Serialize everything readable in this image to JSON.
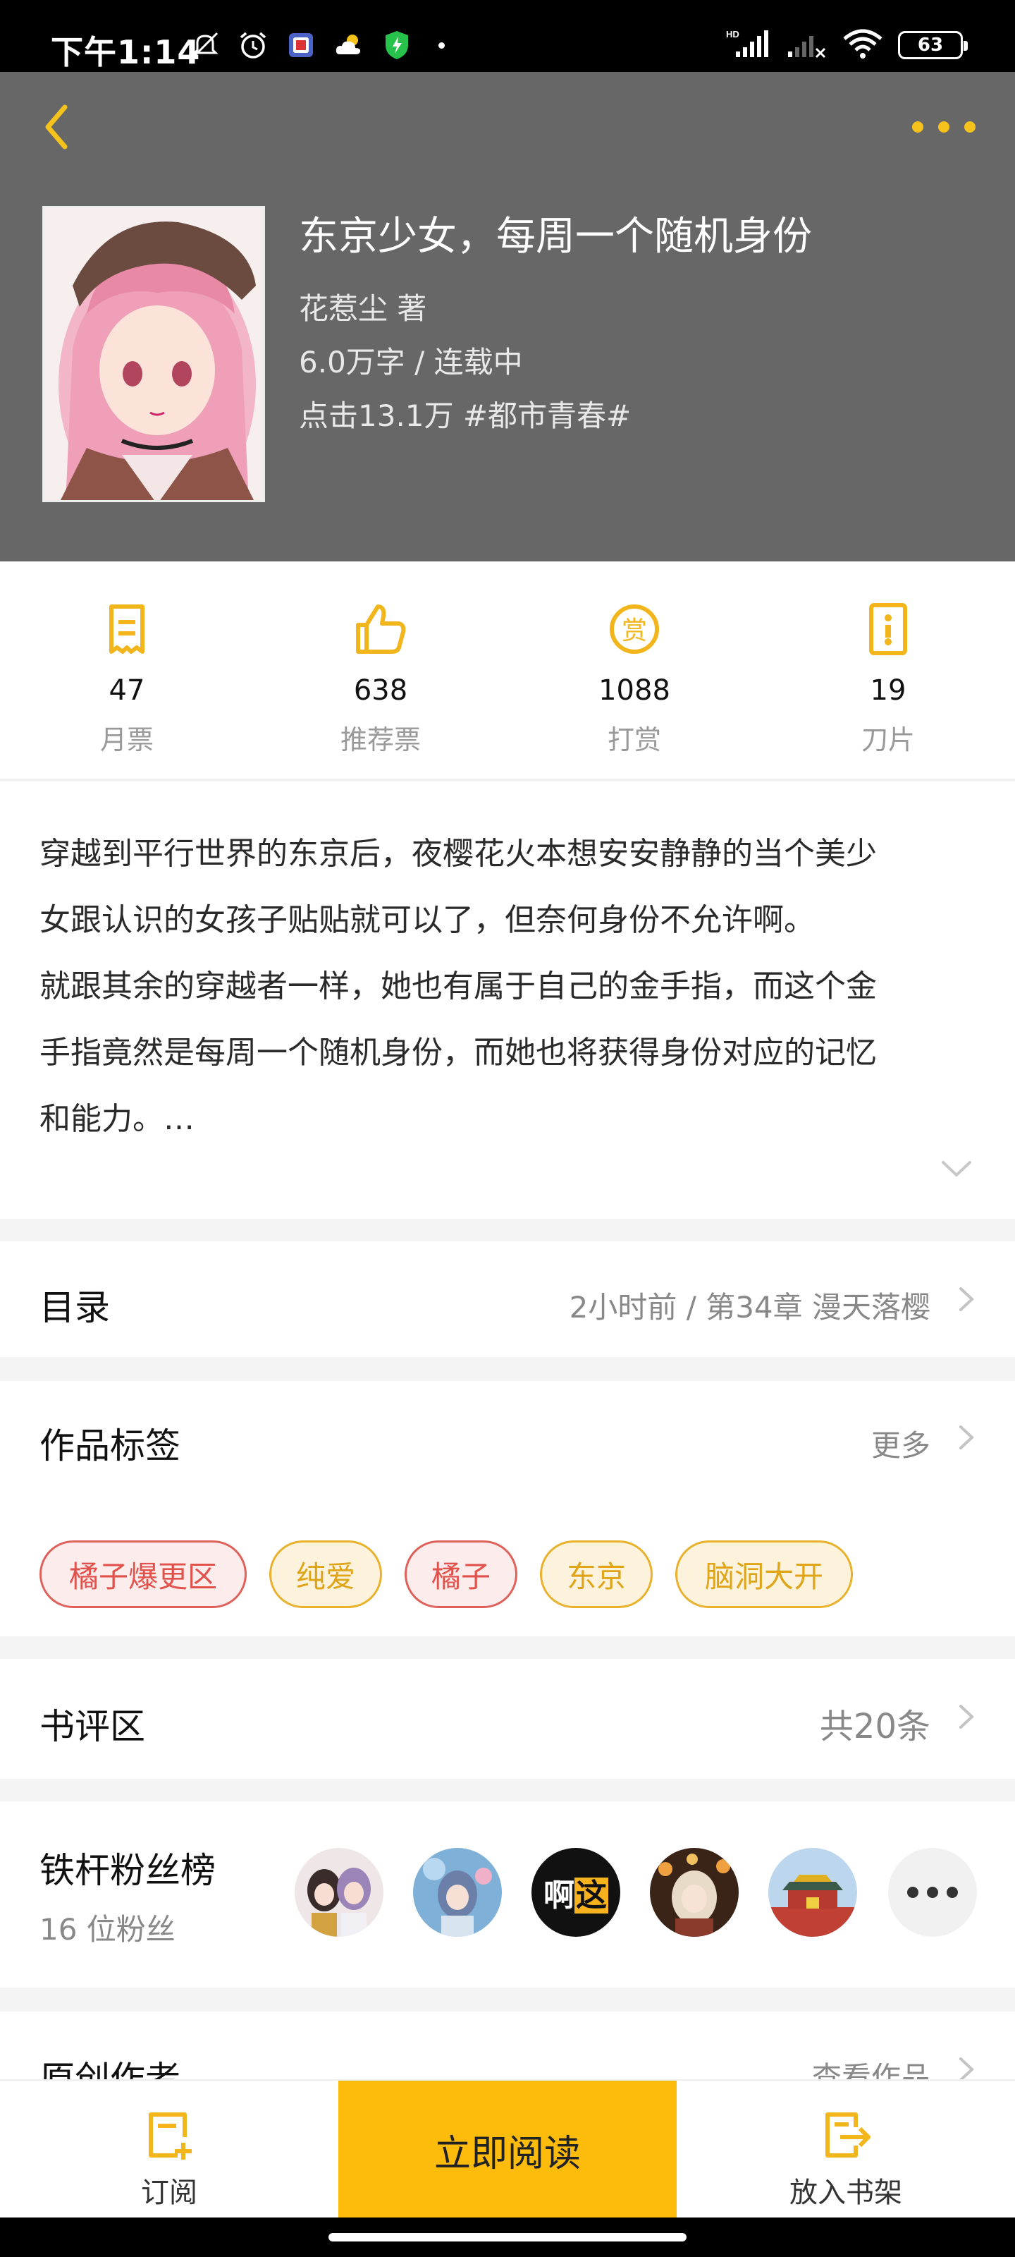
{
  "status_bar": {
    "time": "下午1:14",
    "battery": "63",
    "network": "HD"
  },
  "book": {
    "title": "东京少女，每周一个随机身份",
    "author_line": "花惹尘  著",
    "words_status": "6.0万字 / 连载中",
    "clicks_genre": "点击13.1万  #都市青春#"
  },
  "stats": [
    {
      "icon": "monthly-ticket-icon",
      "value": "47",
      "label": "月票"
    },
    {
      "icon": "thumbs-up-icon",
      "value": "638",
      "label": "推荐票"
    },
    {
      "icon": "reward-coin-icon",
      "value": "1088",
      "label": "打赏"
    },
    {
      "icon": "blade-icon",
      "value": "19",
      "label": "刀片"
    }
  ],
  "synopsis": {
    "lines": [
      "穿越到平行世界的东京后，夜樱花火本想安安静静的当个美少",
      "女跟认识的女孩子贴贴就可以了，但奈何身份不允许啊。",
      "就跟其余的穿越者一样，她也有属于自己的金手指，而这个金",
      "手指竟然是每周一个随机身份，而她也将获得身份对应的记忆",
      "和能力。…"
    ]
  },
  "catalog": {
    "title": "目录",
    "latest": "2小时前 / 第34章 漫天落樱"
  },
  "tags_section": {
    "title": "作品标签",
    "more": "更多",
    "tags": [
      {
        "label": "橘子爆更区",
        "style": "red"
      },
      {
        "label": "纯爱",
        "style": "yellow"
      },
      {
        "label": "橘子",
        "style": "red"
      },
      {
        "label": "东京",
        "style": "yellow"
      },
      {
        "label": "脑洞大开",
        "style": "yellow"
      }
    ]
  },
  "reviews": {
    "title": "书评区",
    "count": "共20条"
  },
  "fans": {
    "title": "铁杆粉丝榜",
    "count": "16 位粉丝",
    "avatar_text": "啊这"
  },
  "author_section": {
    "title": "原创作者",
    "link": "查看作品"
  },
  "bottom_bar": {
    "subscribe": "订阅",
    "read_now": "立即阅读",
    "add_shelf": "放入书架"
  },
  "colors": {
    "accent": "#fdbc0b",
    "header_bg": "#666766",
    "icon_yellow": "#f2b51b"
  }
}
